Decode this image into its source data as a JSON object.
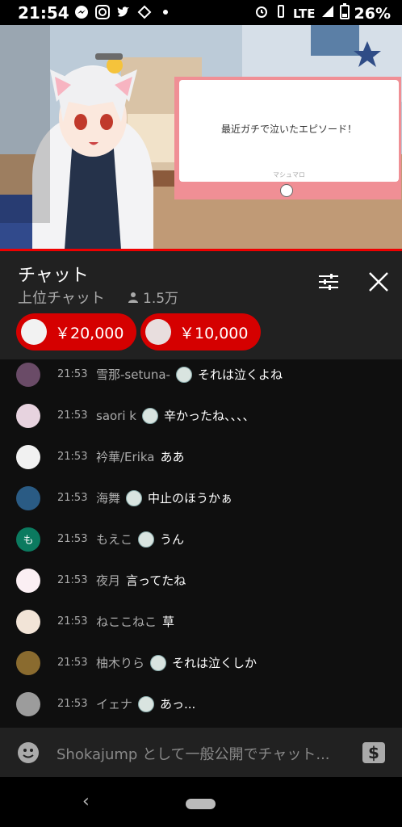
{
  "status_bar": {
    "time": "21:54",
    "network": "LTE",
    "battery": "26%"
  },
  "overlay": {
    "marshmallow_question": "最近ガチで泣いたエピソード！",
    "marshmallow_label": "マシュマロ"
  },
  "chat": {
    "title": "チャット",
    "mode_label": "上位チャット",
    "viewer_count": "1.5万",
    "superchats": [
      {
        "amount": "￥20,000"
      },
      {
        "amount": "￥10,000"
      }
    ],
    "messages": [
      {
        "time": "21:53",
        "author": "雪那-setuna-",
        "text": "それは泣くよね",
        "avatar_color": "#6a4b67"
      },
      {
        "time": "21:53",
        "author": "saori k",
        "text": "辛かったね、、、、",
        "avatar_color": "#e7d3df"
      },
      {
        "time": "21:53",
        "author": "衿華/Erika",
        "text": "ああ",
        "avatar_color": "#f1f1f1"
      },
      {
        "time": "21:53",
        "author": "海舞",
        "text": "中止のほうかぁ",
        "avatar_color": "#2a5b84"
      },
      {
        "time": "21:53",
        "author": "もえこ",
        "text": "うん",
        "avatar_color": "#0b7a5f",
        "avatar_letter": "も"
      },
      {
        "time": "21:53",
        "author": "夜月",
        "text": "言ってたね",
        "avatar_color": "#fbeff3"
      },
      {
        "time": "21:53",
        "author": "ねここねこ",
        "text": "草",
        "avatar_color": "#f2e4d7"
      },
      {
        "time": "21:53",
        "author": "柚木りら",
        "text": "それは泣くしか",
        "avatar_color": "#8a6b2f"
      },
      {
        "time": "21:53",
        "author": "イェナ",
        "text": "あっ...",
        "avatar_color": "#9c9c9c"
      }
    ],
    "input_placeholder": "Shokajump として一般公開でチャット..."
  }
}
